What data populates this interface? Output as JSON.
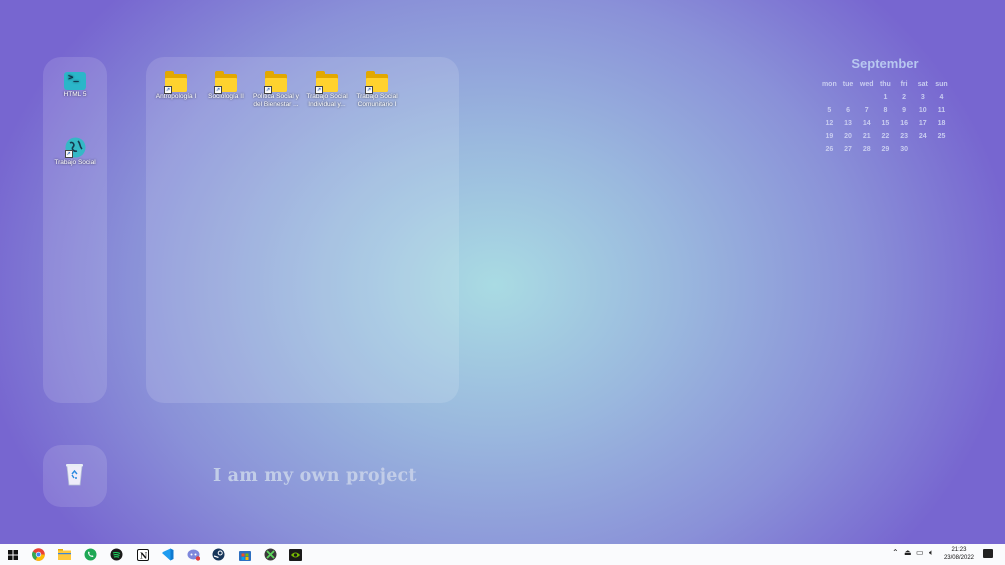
{
  "desktop": {
    "left_icons": [
      {
        "label": "HTML 5",
        "icon": "terminal-icon"
      },
      {
        "label": "Trabajo Social",
        "icon": "globe-icon"
      }
    ],
    "folders": [
      {
        "label": "Antropología I"
      },
      {
        "label": "Sociología II"
      },
      {
        "label": "Política Social y del Bienestar ..."
      },
      {
        "label": "Trabajo Social Individual y..."
      },
      {
        "label": "Trabajo Social Comunitario I"
      }
    ],
    "recycle_bin_icon": "recycle-bin-icon",
    "motto": "I am my own project"
  },
  "calendar": {
    "month": "September",
    "weekdays": [
      "mon",
      "tue",
      "wed",
      "thu",
      "fri",
      "sat",
      "sun"
    ],
    "weeks": [
      [
        "",
        "",
        "",
        "1",
        "2",
        "3",
        "4"
      ],
      [
        "5",
        "6",
        "7",
        "8",
        "9",
        "10",
        "11"
      ],
      [
        "12",
        "13",
        "14",
        "15",
        "16",
        "17",
        "18"
      ],
      [
        "19",
        "20",
        "21",
        "22",
        "23",
        "24",
        "25"
      ],
      [
        "26",
        "27",
        "28",
        "29",
        "30",
        "",
        ""
      ]
    ]
  },
  "taskbar": {
    "apps": [
      "windows-start-icon",
      "chrome-icon",
      "file-explorer-icon",
      "whatsapp-icon",
      "spotify-icon",
      "notion-icon",
      "vscode-icon",
      "discord-icon",
      "steam-icon",
      "microsoft-store-icon",
      "xbox-icon",
      "nvidia-icon"
    ],
    "time": "21:23",
    "date": "23/08/2022"
  },
  "colors": {
    "accent": "#7363cf",
    "folder": "#ffd22e",
    "taskbar": "#fafbfd"
  }
}
